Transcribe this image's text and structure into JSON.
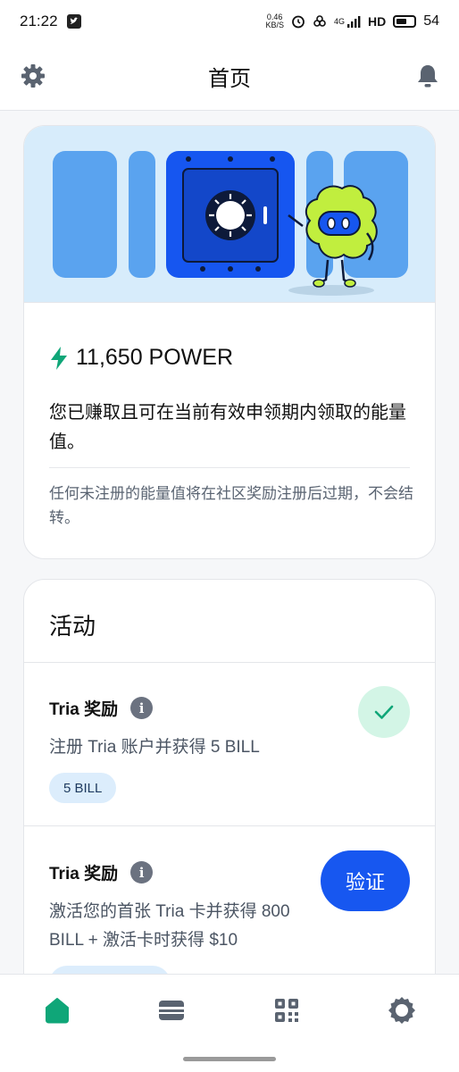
{
  "status_bar": {
    "time": "21:22",
    "net_speed_value": "0.46",
    "net_speed_unit": "KB/S",
    "network": "4G",
    "hd": "HD",
    "battery": "54"
  },
  "header": {
    "title": "首页",
    "left_icon": "gear-icon",
    "right_icon": "bell-icon"
  },
  "power_card": {
    "amount": "11,650 POWER",
    "description": "您已赚取且可在当前有效申领期内领取的能量值。",
    "note": "任何未注册的能量值将在社区奖励注册后过期，不会结转。"
  },
  "activities": {
    "title": "活动",
    "items": [
      {
        "title": "Tria 奖励",
        "description": "注册 Tria 账户并获得 5 BILL",
        "badge": "5 BILL",
        "status": "completed"
      },
      {
        "title": "Tria 奖励",
        "description": "激活您的首张 Tria 卡并获得 800 BILL + 激活卡时获得 $10",
        "action_label": "验证"
      }
    ]
  },
  "bottom_nav": {
    "items": [
      "home-icon",
      "wallet-icon",
      "qr-code-icon",
      "settings-icon"
    ],
    "active": "home-icon"
  },
  "colors": {
    "accent_green": "#0fa678",
    "primary_blue": "#1757f0",
    "hero_bg": "#d7ecfb"
  }
}
